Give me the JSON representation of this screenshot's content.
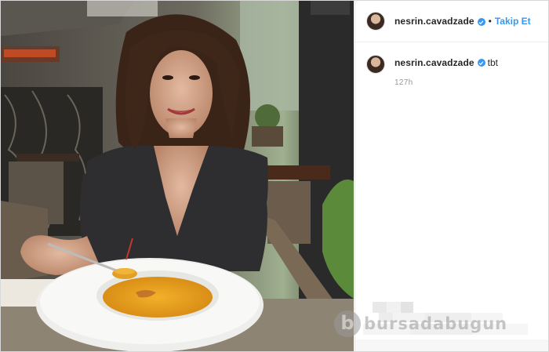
{
  "post": {
    "username": "nesrin.cavadzade",
    "follow_label": "Takip Et",
    "separator": "•",
    "caption_username": "nesrin.cavadzade",
    "caption": "tbt",
    "timestamp": "127h"
  },
  "watermark": {
    "logo_letter": "b",
    "text": "bursadabugun"
  },
  "colors": {
    "link": "#3897f0",
    "verified": "#3897f0",
    "text": "#262626",
    "muted": "#999999"
  },
  "icons": {
    "verified": "verified-badge-icon"
  }
}
